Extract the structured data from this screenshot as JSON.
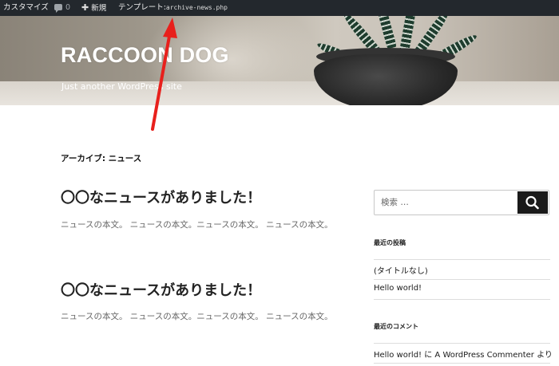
{
  "adminbar": {
    "customize": "カスタマイズ",
    "comments_count": "0",
    "new_label": "新規",
    "template_label": "テンプレート:",
    "template_file": "archive-news.php"
  },
  "header": {
    "site_title": "RACCOON DOG",
    "site_description": "Just another WordPress site"
  },
  "main": {
    "archive_title": "アーカイブ: ニュース",
    "posts": [
      {
        "title": "〇〇なニュースがありました！",
        "body": "ニュースの本文。 ニュースの本文。ニュースの本文。 ニュースの本文。"
      },
      {
        "title": "〇〇なニュースがありました！",
        "body": "ニュースの本文。 ニュースの本文。ニュースの本文。 ニュースの本文。"
      }
    ]
  },
  "sidebar": {
    "search_placeholder": "検索 …",
    "recent_posts_title": "最近の投稿",
    "recent_posts": [
      "(タイトルなし)",
      "Hello world!"
    ],
    "recent_comments_title": "最近のコメント",
    "recent_comments": [
      "Hello world! に A WordPress Commenter より"
    ]
  },
  "colors": {
    "adminbar_bg": "#23282d",
    "annotation_arrow": "#e8201c",
    "search_button_bg": "#1a1a1a"
  },
  "icons": {
    "comments": "comment-bubble-icon",
    "new": "plus-icon",
    "search": "search-icon"
  }
}
